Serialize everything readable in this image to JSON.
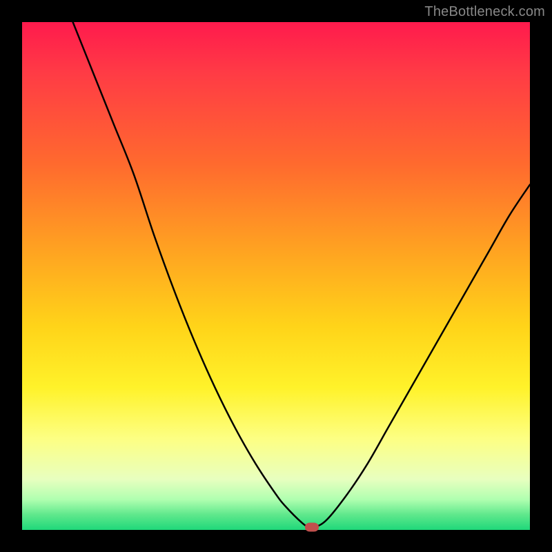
{
  "watermark": "TheBottleneck.com",
  "colors": {
    "frame": "#000000",
    "curve": "#000000",
    "marker_fill": "#c0504d"
  },
  "chart_data": {
    "type": "line",
    "title": "",
    "xlabel": "",
    "ylabel": "",
    "xlim": [
      0,
      100
    ],
    "ylim": [
      0,
      100
    ],
    "grid": false,
    "legend": false,
    "series": [
      {
        "name": "curve",
        "x": [
          10,
          14,
          18,
          22,
          26,
          30,
          34,
          38,
          42,
          46,
          50,
          52,
          55,
          56.5,
          57.5,
          60,
          64,
          68,
          72,
          76,
          80,
          84,
          88,
          92,
          96,
          100
        ],
        "values": [
          100,
          90,
          80,
          70,
          58,
          47,
          37,
          28,
          20,
          13,
          7,
          4.5,
          1.5,
          0.5,
          0.5,
          2,
          7,
          13,
          20,
          27,
          34,
          41,
          48,
          55,
          62,
          68
        ]
      }
    ],
    "marker": {
      "x": 57,
      "y": 0.5
    }
  }
}
